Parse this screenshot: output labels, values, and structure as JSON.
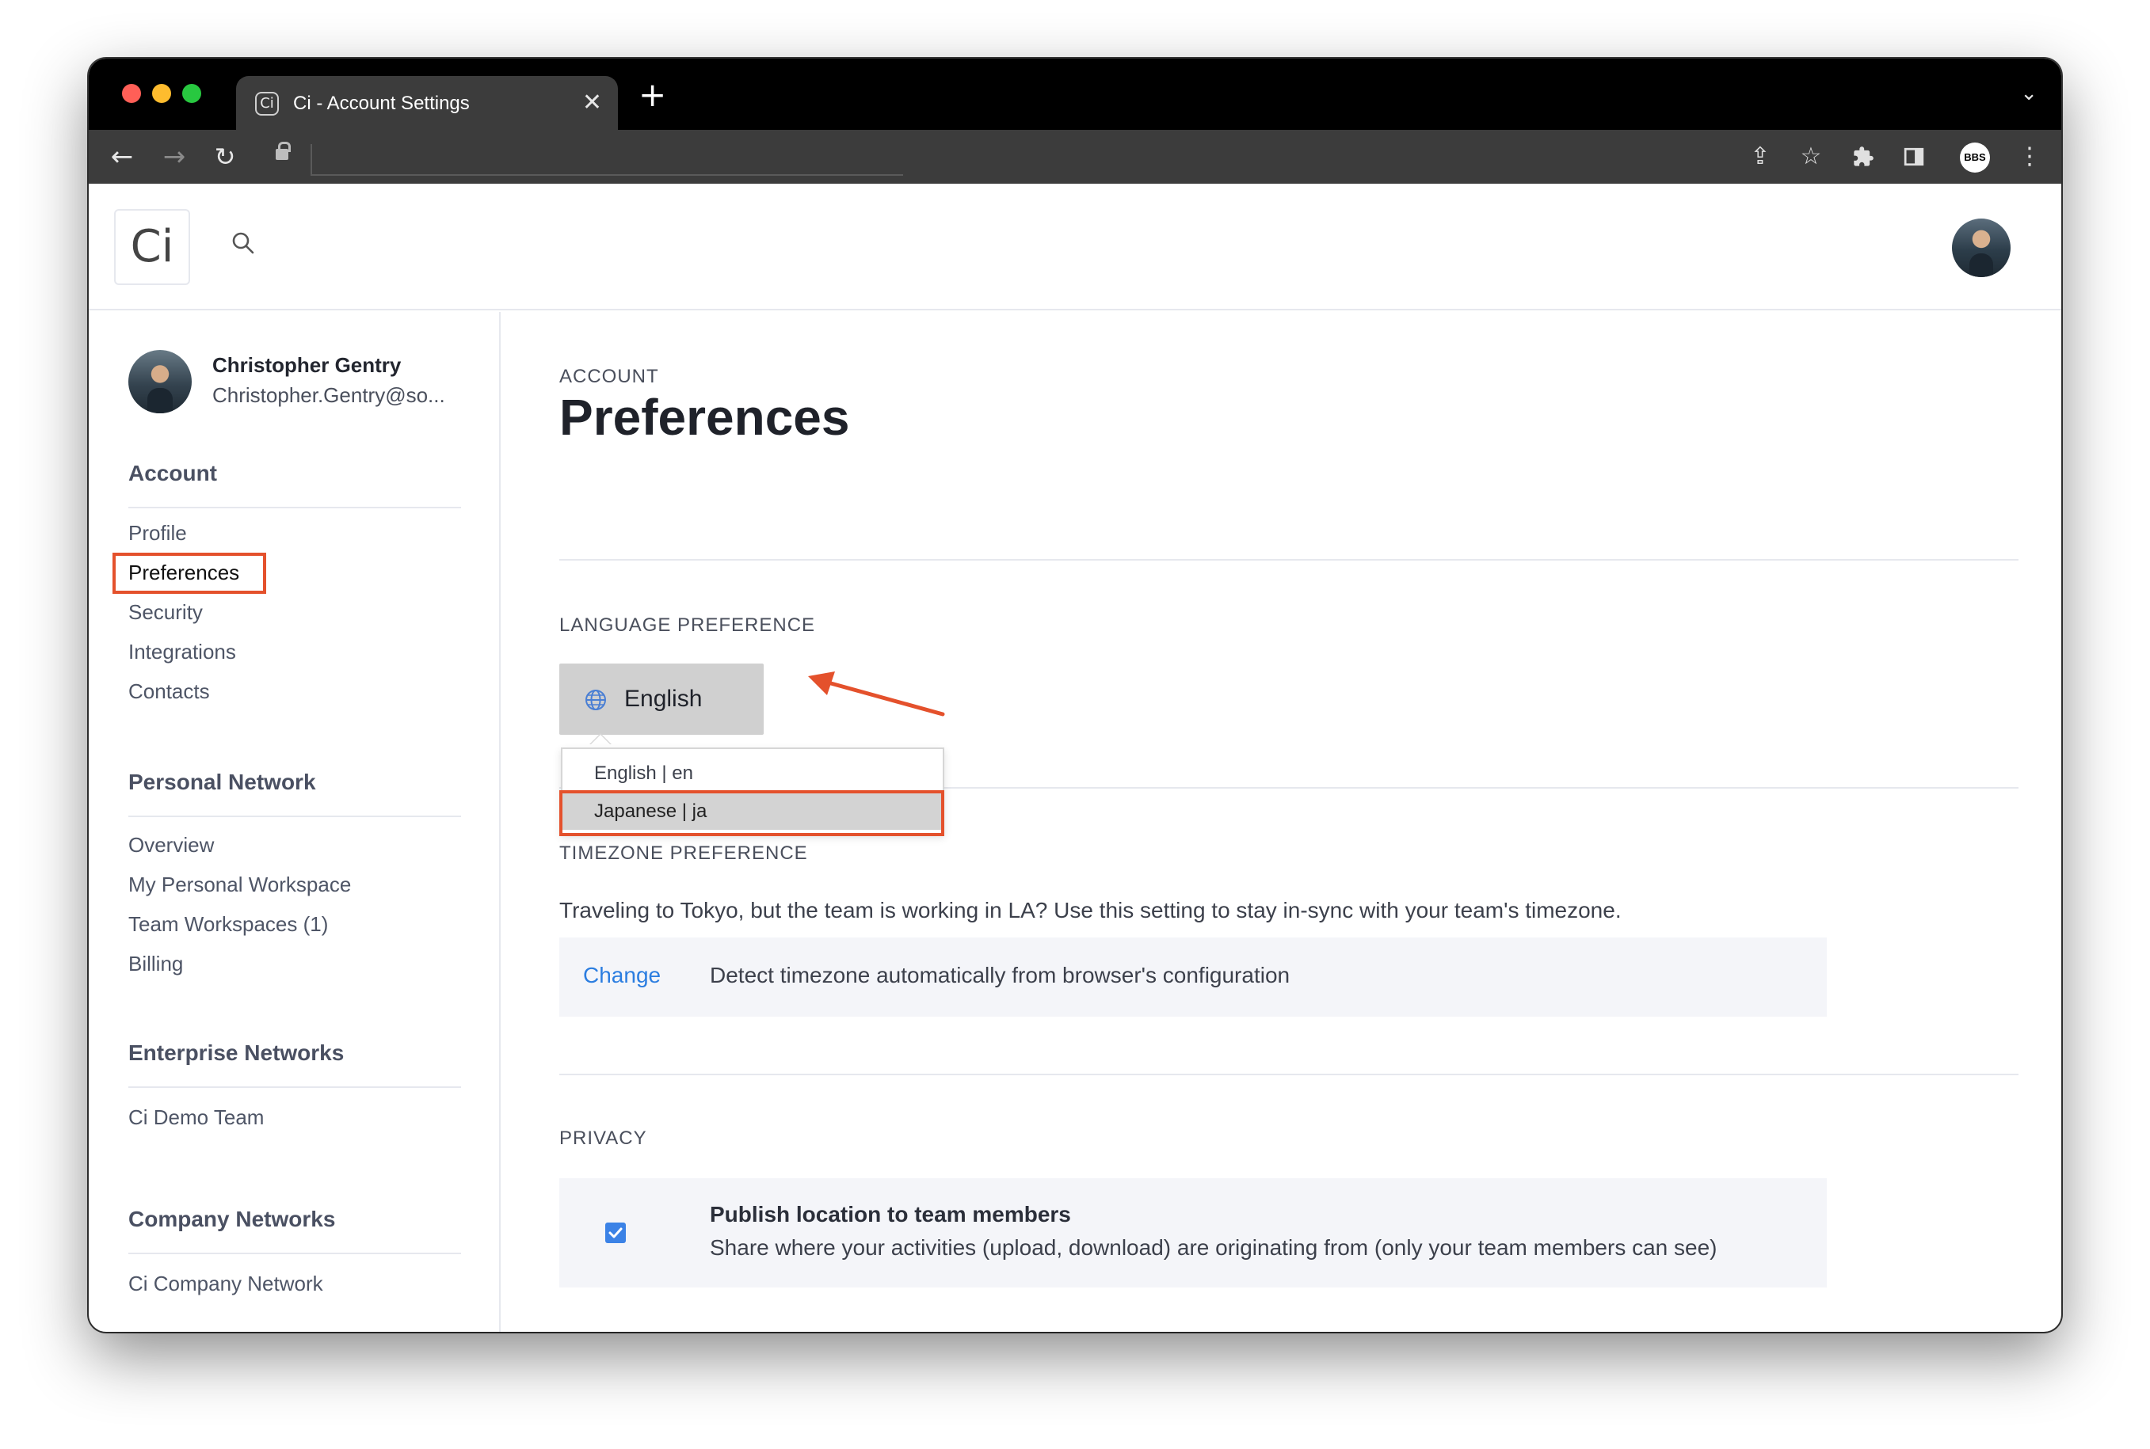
{
  "browser": {
    "tab_title": "Ci - Account Settings",
    "tab_favicon": "Ci",
    "close_glyph": "✕",
    "new_tab_glyph": "+",
    "tab_menu_glyph": "⌄",
    "profile_badge": "BBS",
    "icons": [
      "back-arrow-icon",
      "forward-arrow-icon",
      "reload-icon",
      "lock-icon",
      "share-icon",
      "star-icon",
      "extensions-icon",
      "sidebar-icon",
      "more-icon"
    ]
  },
  "app": {
    "logo": "Ci"
  },
  "user": {
    "name": "Christopher Gentry",
    "email": "Christopher.Gentry@so..."
  },
  "sidebar": {
    "sections": [
      {
        "title": "Account",
        "items": [
          "Profile",
          "Preferences",
          "Security",
          "Integrations",
          "Contacts"
        ]
      },
      {
        "title": "Personal Network",
        "items": [
          "Overview",
          "My Personal Workspace",
          "Team Workspaces (1)",
          "Billing"
        ]
      },
      {
        "title": "Enterprise Networks",
        "items": [
          "Ci Demo Team"
        ]
      },
      {
        "title": "Company Networks",
        "items": [
          "Ci Company Network"
        ]
      }
    ],
    "active_item": "Preferences"
  },
  "main": {
    "eyebrow": "ACCOUNT",
    "title": "Preferences",
    "language": {
      "label": "LANGUAGE PREFERENCE",
      "current": "English",
      "options": [
        "English | en",
        "Japanese | ja"
      ],
      "hovered_option": "Japanese | ja"
    },
    "timezone": {
      "label": "TIMEZONE PREFERENCE",
      "description": "Traveling to Tokyo, but the team is working in LA? Use this setting to stay in-sync with your team's timezone.",
      "change_label": "Change",
      "value": "Detect timezone automatically from browser's configuration"
    },
    "privacy": {
      "label": "PRIVACY",
      "checked": true,
      "title": "Publish location to team members",
      "description": "Share where your activities (upload, download) are originating from (only your team members can see)"
    }
  },
  "colors": {
    "highlight": "#e4512c",
    "link": "#2b7de0",
    "checkbox": "#3b82e6",
    "chrome_dark": "#000000",
    "chrome_toolbar": "#3c3c3c"
  }
}
